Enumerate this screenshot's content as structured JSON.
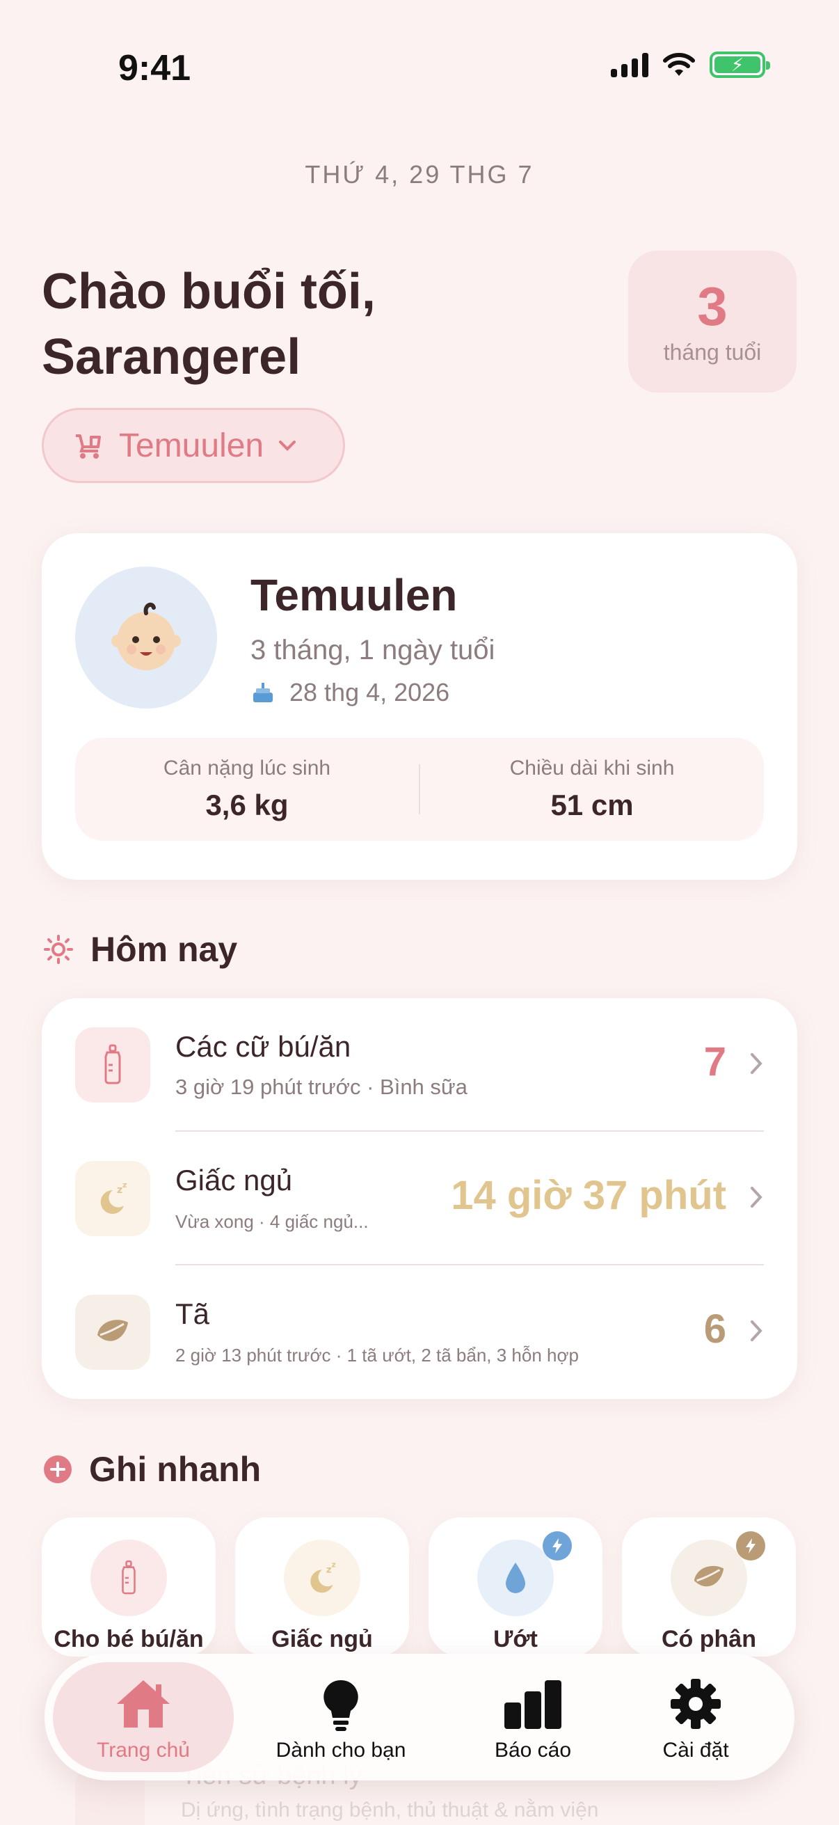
{
  "status": {
    "time": "9:41"
  },
  "date": "THỨ 4, 29 THG 7",
  "greeting": "Chào buổi tối, Sarangerel",
  "age_badge": {
    "number": "3",
    "label": "tháng tuổi"
  },
  "child_selector": {
    "name": "Temuulen"
  },
  "profile": {
    "name": "Temuulen",
    "age": "3 tháng, 1 ngày tuổi",
    "birthday": "28 thg 4, 2026",
    "birth_weight_label": "Cân nặng lúc sinh",
    "birth_weight": "3,6 kg",
    "birth_length_label": "Chiều dài khi sinh",
    "birth_length": "51 cm"
  },
  "today": {
    "title": "Hôm nay",
    "rows": [
      {
        "title": "Các cữ bú/ăn",
        "subtitle": "3 giờ 19 phút trước · Bình sữa",
        "value": "7",
        "color": "#e07a85"
      },
      {
        "title": "Giấc ngủ",
        "subtitle": "Vừa xong · 4 giấc ngủ...",
        "value": "14 giờ 37 phút",
        "color": "#e0c58f"
      },
      {
        "title": "Tã",
        "subtitle": "2 giờ 13 phút trước · 1 tã ướt, 2 tã bẩn, 3 hỗn hợp",
        "value": "6",
        "color": "#b99b76"
      }
    ]
  },
  "quick": {
    "title": "Ghi nhanh",
    "items": [
      {
        "label": "Cho bé bú/ăn"
      },
      {
        "label": "Giấc ngủ"
      },
      {
        "label": "Ướt"
      },
      {
        "label": "Có phân"
      }
    ]
  },
  "faded_row": {
    "title": "Tiền sử bệnh lý",
    "subtitle": "Dị ứng, tình trạng bệnh, thủ thuật & nằm viện"
  },
  "tabs": [
    {
      "label": "Trang chủ",
      "icon": "house-icon"
    },
    {
      "label": "Dành cho bạn",
      "icon": "lightbulb-icon"
    },
    {
      "label": "Báo cáo",
      "icon": "chart-icon"
    },
    {
      "label": "Cài đặt",
      "icon": "gear-icon"
    }
  ],
  "colors": {
    "accent": "#e07a85",
    "sleep": "#e0c58f",
    "diaper": "#b99b76",
    "background": "#fbf2f1"
  }
}
